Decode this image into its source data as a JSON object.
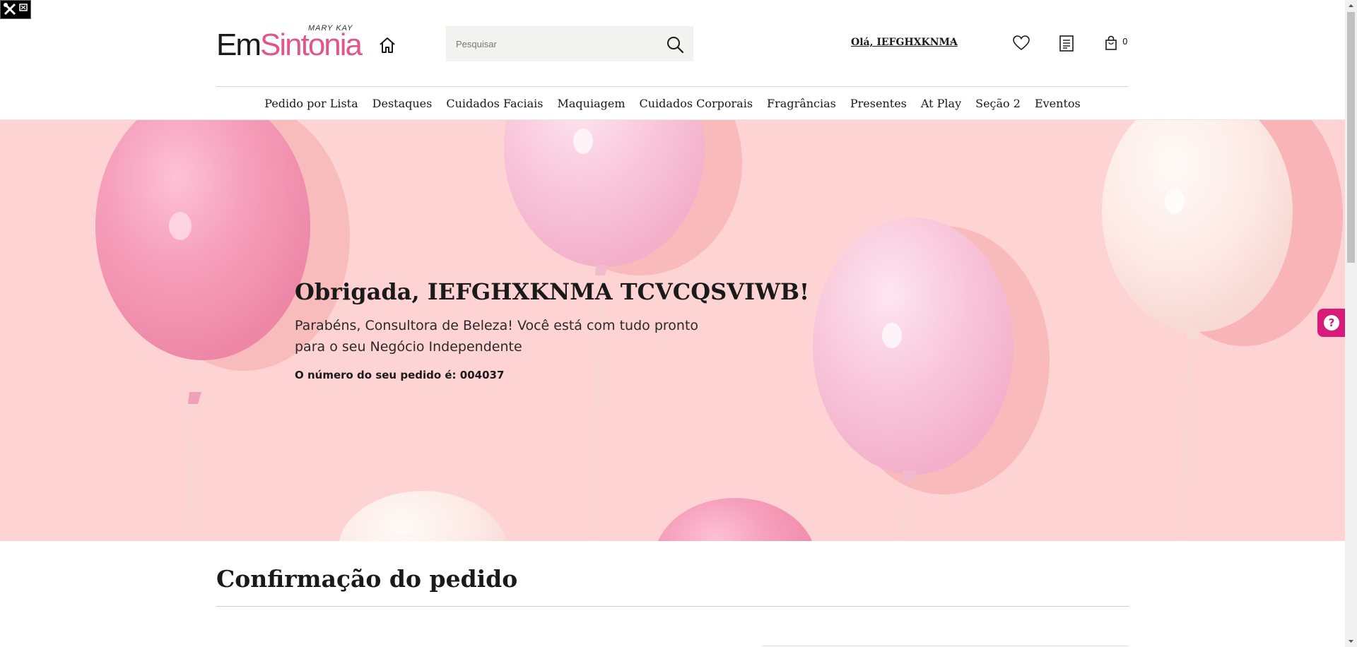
{
  "brand": {
    "mk": "MARY KAY",
    "em": "Em",
    "sintonia": "Sintonia"
  },
  "header": {
    "search_placeholder": "Pesquisar",
    "greeting": "Olá, IEFGHXKNMA",
    "bag_count": "0"
  },
  "nav": {
    "items": [
      "Pedido por Lista",
      "Destaques",
      "Cuidados Faciais",
      "Maquiagem",
      "Cuidados Corporais",
      "Fragrâncias",
      "Presentes",
      "At Play",
      "Seção 2",
      "Eventos"
    ]
  },
  "hero": {
    "title": "Obrigada, IEFGHXKNMA TCVCQSVIWB!",
    "subtitle": "Parabéns, Consultora de Beleza! Você está com tudo pronto para o seu Negócio Independente",
    "order_text": "O número do seu pedido é: 004037"
  },
  "help": {
    "symbol": "?"
  },
  "content": {
    "section_title": "Confirmação do pedido"
  },
  "colors": {
    "hero_bg": "#fdd3d3",
    "accent_pink": "#d81b7a",
    "logo_pink": "#e0578a"
  }
}
